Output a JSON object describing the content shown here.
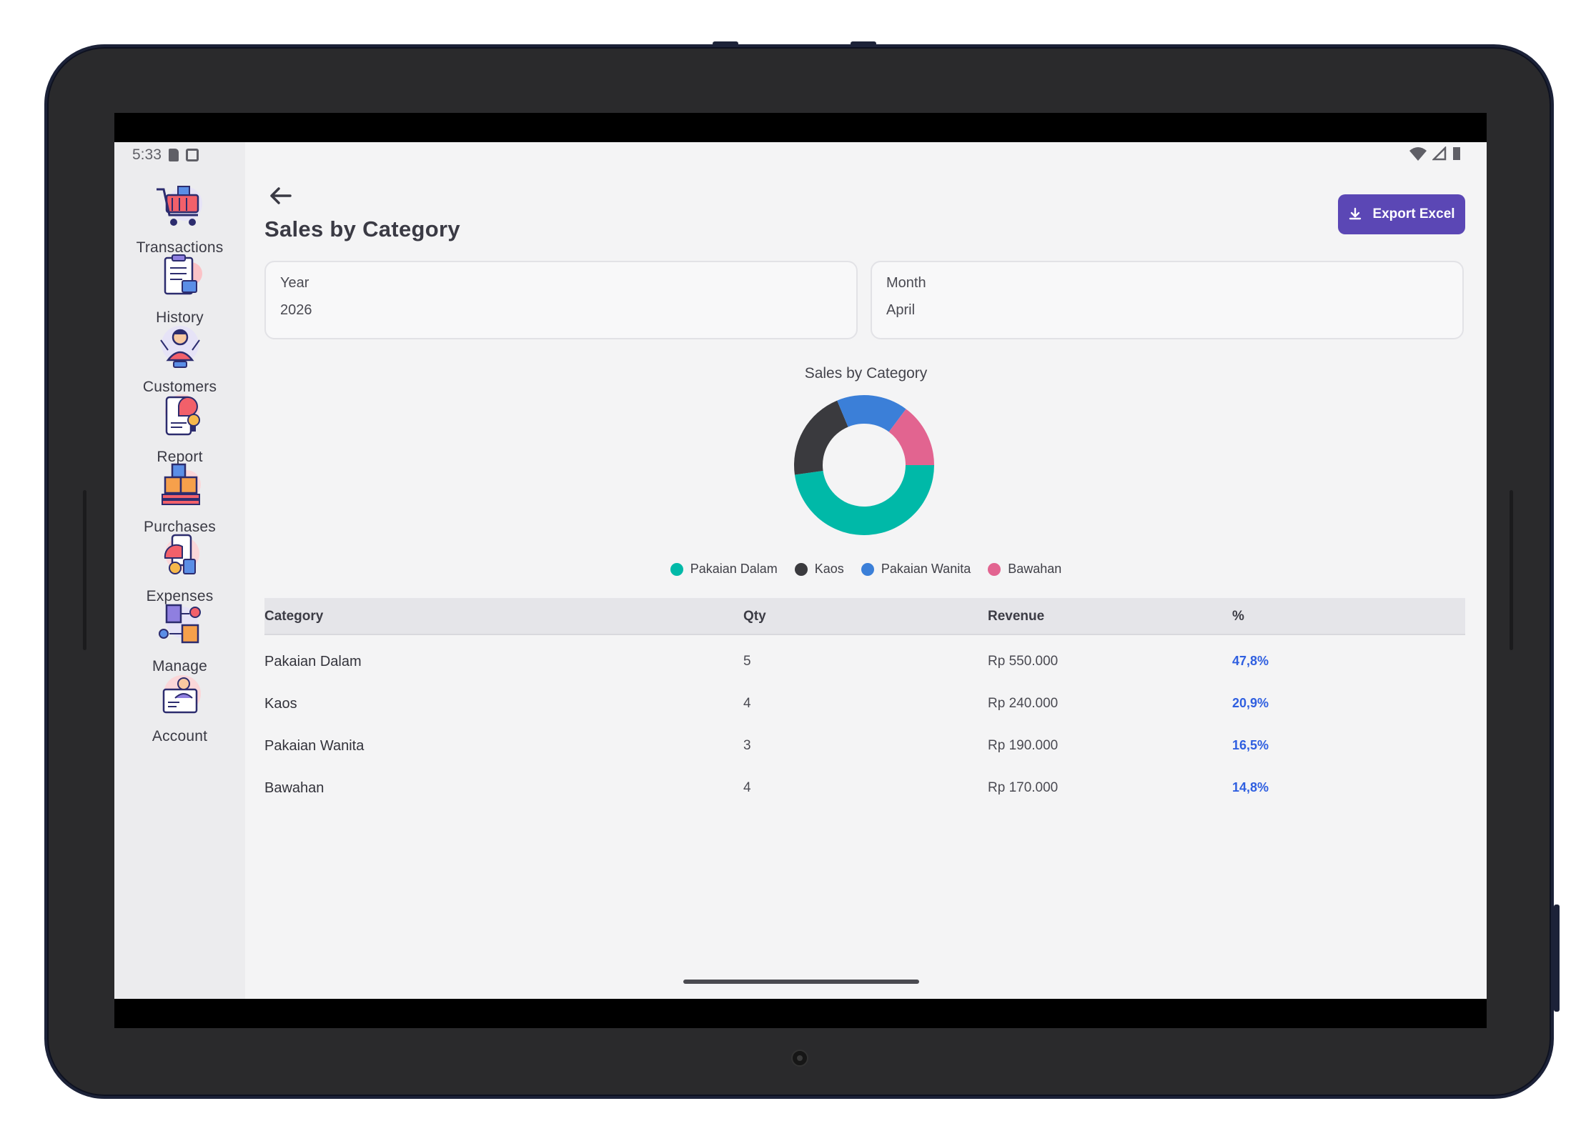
{
  "status": {
    "time": "5:33"
  },
  "nav": [
    {
      "label": "Transactions",
      "icon": "shopping-cart-icon"
    },
    {
      "label": "History",
      "icon": "clipboard-history-icon"
    },
    {
      "label": "Customers",
      "icon": "customer-person-icon"
    },
    {
      "label": "Report",
      "icon": "report-chart-icon"
    },
    {
      "label": "Purchases",
      "icon": "boxes-pallet-icon"
    },
    {
      "label": "Expenses",
      "icon": "expenses-wallet-icon"
    },
    {
      "label": "Manage",
      "icon": "manage-flow-icon"
    },
    {
      "label": "Account",
      "icon": "account-person-icon"
    }
  ],
  "page": {
    "title": "Sales by Category"
  },
  "toolbar": {
    "export_label": "Export Excel"
  },
  "filters": {
    "year": {
      "label": "Year",
      "value": "2026"
    },
    "month": {
      "label": "Month",
      "value": "April"
    }
  },
  "chart_data": {
    "type": "pie",
    "title": "Sales by Category",
    "categories": [
      "Pakaian Dalam",
      "Kaos",
      "Pakaian Wanita",
      "Bawahan"
    ],
    "values": [
      47.8,
      20.9,
      16.5,
      14.8
    ],
    "colors": [
      "#00b9a8",
      "#3a3a3e",
      "#3b7fd8",
      "#e26490"
    ],
    "donut": true,
    "legend": "bottom"
  },
  "table": {
    "headers": {
      "category": "Category",
      "qty": "Qty",
      "revenue": "Revenue",
      "pct": "%"
    },
    "rows": [
      {
        "category": "Pakaian Dalam",
        "qty": "5",
        "revenue": "Rp 550.000",
        "pct": "47,8%"
      },
      {
        "category": "Kaos",
        "qty": "4",
        "revenue": "Rp 240.000",
        "pct": "20,9%"
      },
      {
        "category": "Pakaian Wanita",
        "qty": "3",
        "revenue": "Rp 190.000",
        "pct": "16,5%"
      },
      {
        "category": "Bawahan",
        "qty": "4",
        "revenue": "Rp 170.000",
        "pct": "14,8%"
      }
    ]
  },
  "colors": {
    "accent": "#5b47b5",
    "percent": "#2f5fe0"
  }
}
